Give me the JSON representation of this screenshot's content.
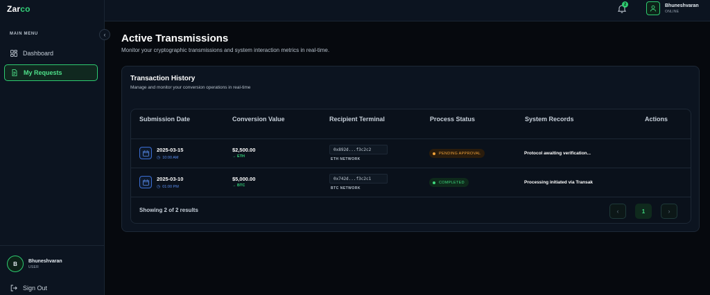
{
  "brand": {
    "name_main": "Zar",
    "name_accent": "co"
  },
  "sidebar": {
    "menu_label": "MAIN MENU",
    "items": [
      {
        "label": "Dashboard",
        "icon": "dashboard-icon"
      },
      {
        "label": "My Requests",
        "icon": "document-icon",
        "active": true
      }
    ],
    "user": {
      "initial": "B",
      "name": "Bhuneshvaran",
      "role": "USER"
    },
    "signout_label": "Sign Out"
  },
  "topbar": {
    "notification_count": "2",
    "user": {
      "name": "Bhuneshvaran",
      "status": "ONLINE"
    }
  },
  "page": {
    "title": "Active Transmissions",
    "subtitle": "Monitor your cryptographic transmissions and system interaction metrics in real-time."
  },
  "card": {
    "title": "Transaction History",
    "subtitle": "Manage and monitor your conversion operations in real-time"
  },
  "table": {
    "headers": [
      "Submission Date",
      "Conversion Value",
      "Recipient Terminal",
      "Process Status",
      "System Records",
      "Actions"
    ],
    "rows": [
      {
        "date": "2025-03-15",
        "time": "10:00 AM",
        "value": "$2,500.00",
        "currency": "ETH",
        "address": "0x892d...f3c2c2",
        "network": "ETH NETWORK",
        "status": "PENDING APPROVAL",
        "record": "Protocol awaiting verification..."
      },
      {
        "date": "2025-03-10",
        "time": "01:00 PM",
        "value": "$5,000.00",
        "currency": "BTC",
        "address": "0x742d...f3c2c1",
        "network": "BTC NETWORK",
        "status": "COMPLETED",
        "record": "Processing initiated via Transak"
      }
    ],
    "footer": {
      "showing": "Showing 2 of 2 results",
      "page": "1"
    }
  },
  "colors": {
    "accent": "#2ecc71",
    "pending": "#f0a23a",
    "link_blue": "#5a8ef0",
    "background": "#06090e"
  }
}
